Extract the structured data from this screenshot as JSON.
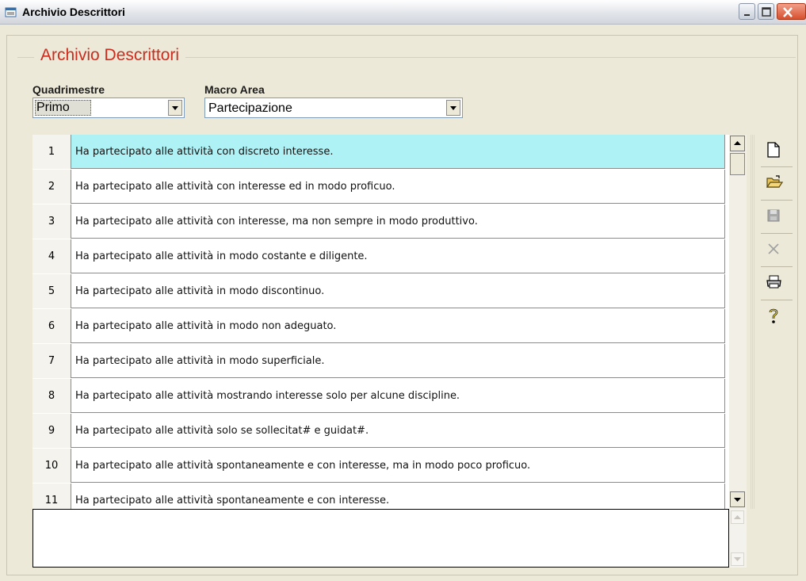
{
  "window": {
    "title": "Archivio Descrittori"
  },
  "group": {
    "title": "Archivio Descrittori"
  },
  "filters": {
    "quadrimestre_label": "Quadrimestre",
    "quadrimestre_value": "Primo",
    "macro_area_label": "Macro Area",
    "macro_area_value": "Partecipazione"
  },
  "rows": [
    {
      "num": "1",
      "text": "Ha partecipato alle attività con discreto interesse."
    },
    {
      "num": "2",
      "text": "Ha partecipato alle attività con interesse ed in modo proficuo."
    },
    {
      "num": "3",
      "text": "Ha partecipato alle attività con interesse, ma non sempre in modo produttivo."
    },
    {
      "num": "4",
      "text": "Ha partecipato alle attività in modo costante e diligente."
    },
    {
      "num": "5",
      "text": "Ha partecipato alle attività in modo discontinuo."
    },
    {
      "num": "6",
      "text": "Ha partecipato alle attività in modo non adeguato."
    },
    {
      "num": "7",
      "text": "Ha partecipato alle attività in modo superficiale."
    },
    {
      "num": "8",
      "text": "Ha partecipato alle attività mostrando interesse solo per alcune discipline."
    },
    {
      "num": "9",
      "text": "Ha partecipato alle attività solo se sollecitat# e guidat#."
    },
    {
      "num": "10",
      "text": "Ha partecipato alle attività spontaneamente e con interesse, ma in modo poco proficuo."
    },
    {
      "num": "11",
      "text": "Ha partecipato alle attività spontaneamente e con interesse."
    }
  ],
  "selected_row": "1",
  "memo": {
    "value": ""
  },
  "toolbar": {
    "icons": [
      "new-document-icon",
      "open-folder-icon",
      "save-icon",
      "delete-icon",
      "print-icon",
      "help-icon"
    ]
  },
  "colors": {
    "selection": "#aef2f5",
    "group_title": "#cc2c1e",
    "window_bg": "#ece9d8"
  }
}
